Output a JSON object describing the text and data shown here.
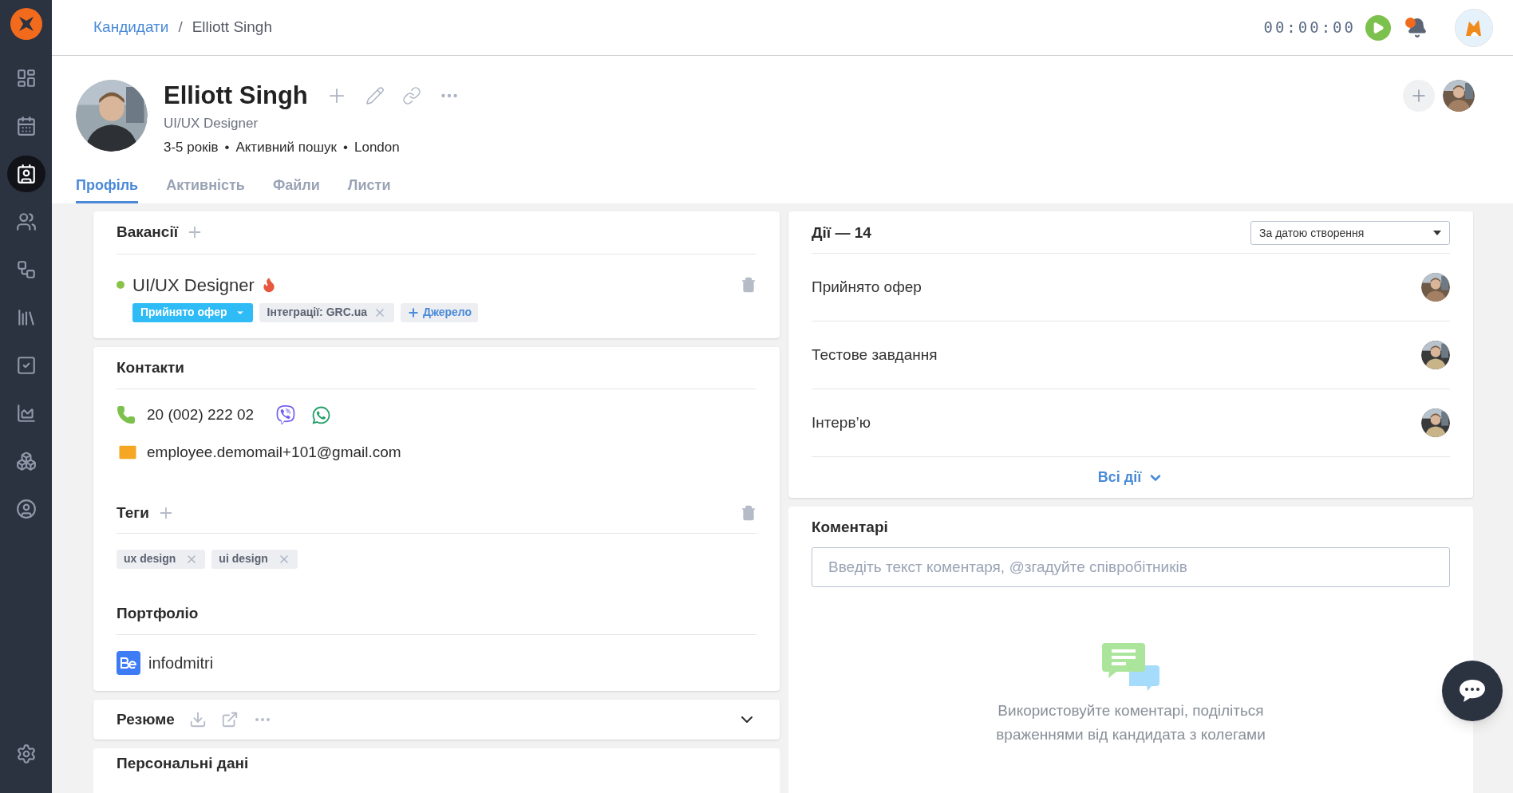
{
  "sidebar": {
    "items": [
      {
        "selected": false
      },
      {
        "selected": false
      },
      {
        "selected": true
      },
      {
        "selected": false
      },
      {
        "selected": false
      },
      {
        "selected": false
      },
      {
        "selected": false
      },
      {
        "selected": false
      },
      {
        "selected": false
      },
      {
        "selected": false
      }
    ]
  },
  "breadcrumbs": [
    {
      "label": "Кандидати",
      "link": true
    },
    {
      "label": "Elliott Singh",
      "link": false
    }
  ],
  "breadcrumb_separator": "/",
  "timer": "00:00:00",
  "notifications": {
    "unread": true
  },
  "candidate": {
    "name": "Elliott Singh",
    "position": "UI/UX Designer",
    "details": [
      "3-5 років",
      "Активний пошук",
      "London"
    ],
    "detail_separator": "•"
  },
  "tabs": [
    {
      "label": "Профіль",
      "selected": true
    },
    {
      "label": "Активність",
      "selected": false
    },
    {
      "label": "Файли",
      "selected": false
    },
    {
      "label": "Листи",
      "selected": false
    }
  ],
  "vacancies": {
    "title": "Вакансії",
    "items": [
      {
        "title": "UI/UX Designer",
        "color": "#8bc34a",
        "hot": true,
        "status": "Прийнято офер",
        "source": "Інтеграції: GRC.ua",
        "add_source": "Джерело"
      }
    ]
  },
  "contacts": {
    "title": "Контакти",
    "phone": "20 (002) 222 02",
    "email": "employee.demomail+101@gmail.com"
  },
  "tags": {
    "title": "Теги",
    "items": [
      "ux design",
      "ui design"
    ]
  },
  "portfolio": {
    "title": "Портфоліо",
    "items": [
      {
        "label": "infodmitri"
      }
    ]
  },
  "resume": {
    "title": "Резюме",
    "expanded": false
  },
  "personal": {
    "title": "Персональні дані"
  },
  "actions": {
    "title": "Дії — 14",
    "sort": "За датою створення",
    "items": [
      {
        "title": "Прийнято офер"
      },
      {
        "title": "Тестове завдання"
      },
      {
        "title": "Інтерв’ю"
      }
    ],
    "show_all": "Всі дії"
  },
  "comments": {
    "title": "Коментарі",
    "placeholder": "Введіть текст коментаря, @згадуйте співробітників",
    "empty_text": "Використовуйте коментарі, поділіться враженнями від кандидата з колегами"
  }
}
